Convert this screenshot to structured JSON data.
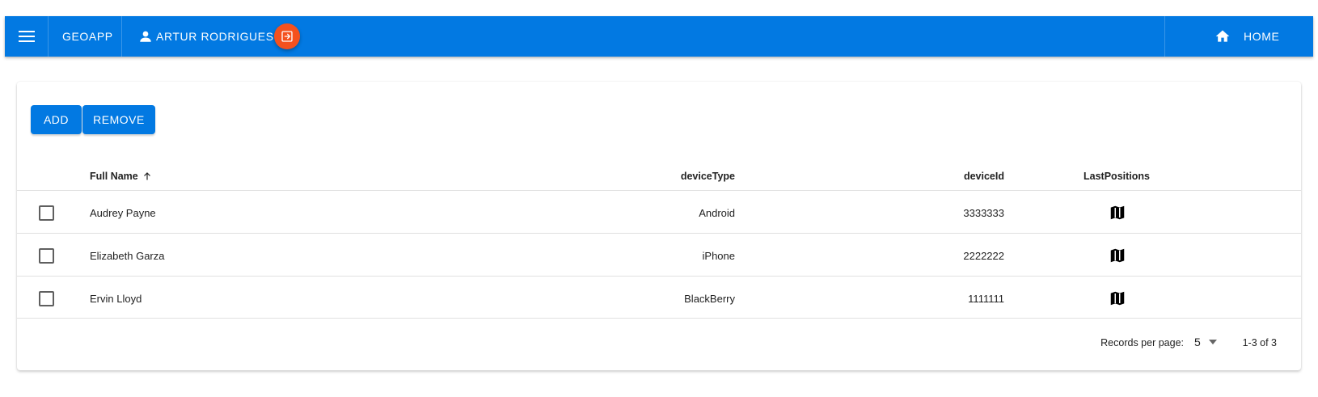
{
  "toolbar": {
    "brand": "GEOAPP",
    "user_name": "ARTUR RODRIGUES",
    "home_label": "HOME",
    "color": "#0279e2",
    "logout_color": "#f4511e",
    "icons": [
      "menu-icon",
      "person-icon",
      "logout-icon",
      "home-icon"
    ]
  },
  "actions": {
    "add_label": "ADD",
    "remove_label": "REMOVE"
  },
  "table": {
    "headers": {
      "name": "Full Name",
      "device_type": "deviceType",
      "device_id": "deviceId",
      "last_positions": "LastPositions"
    },
    "sort": "Full Name ascending",
    "rows": [
      {
        "name": "Audrey Payne",
        "device_type": "Android",
        "device_id": "3333333",
        "checked": false
      },
      {
        "name": "Elizabeth Garza",
        "device_type": "iPhone",
        "device_id": "2222222",
        "checked": false
      },
      {
        "name": "Ervin Lloyd",
        "device_type": "BlackBerry",
        "device_id": "1111111",
        "checked": false
      }
    ]
  },
  "pagination": {
    "records_label": "Records per page:",
    "per_page": "5",
    "range": "1-3 of 3"
  }
}
